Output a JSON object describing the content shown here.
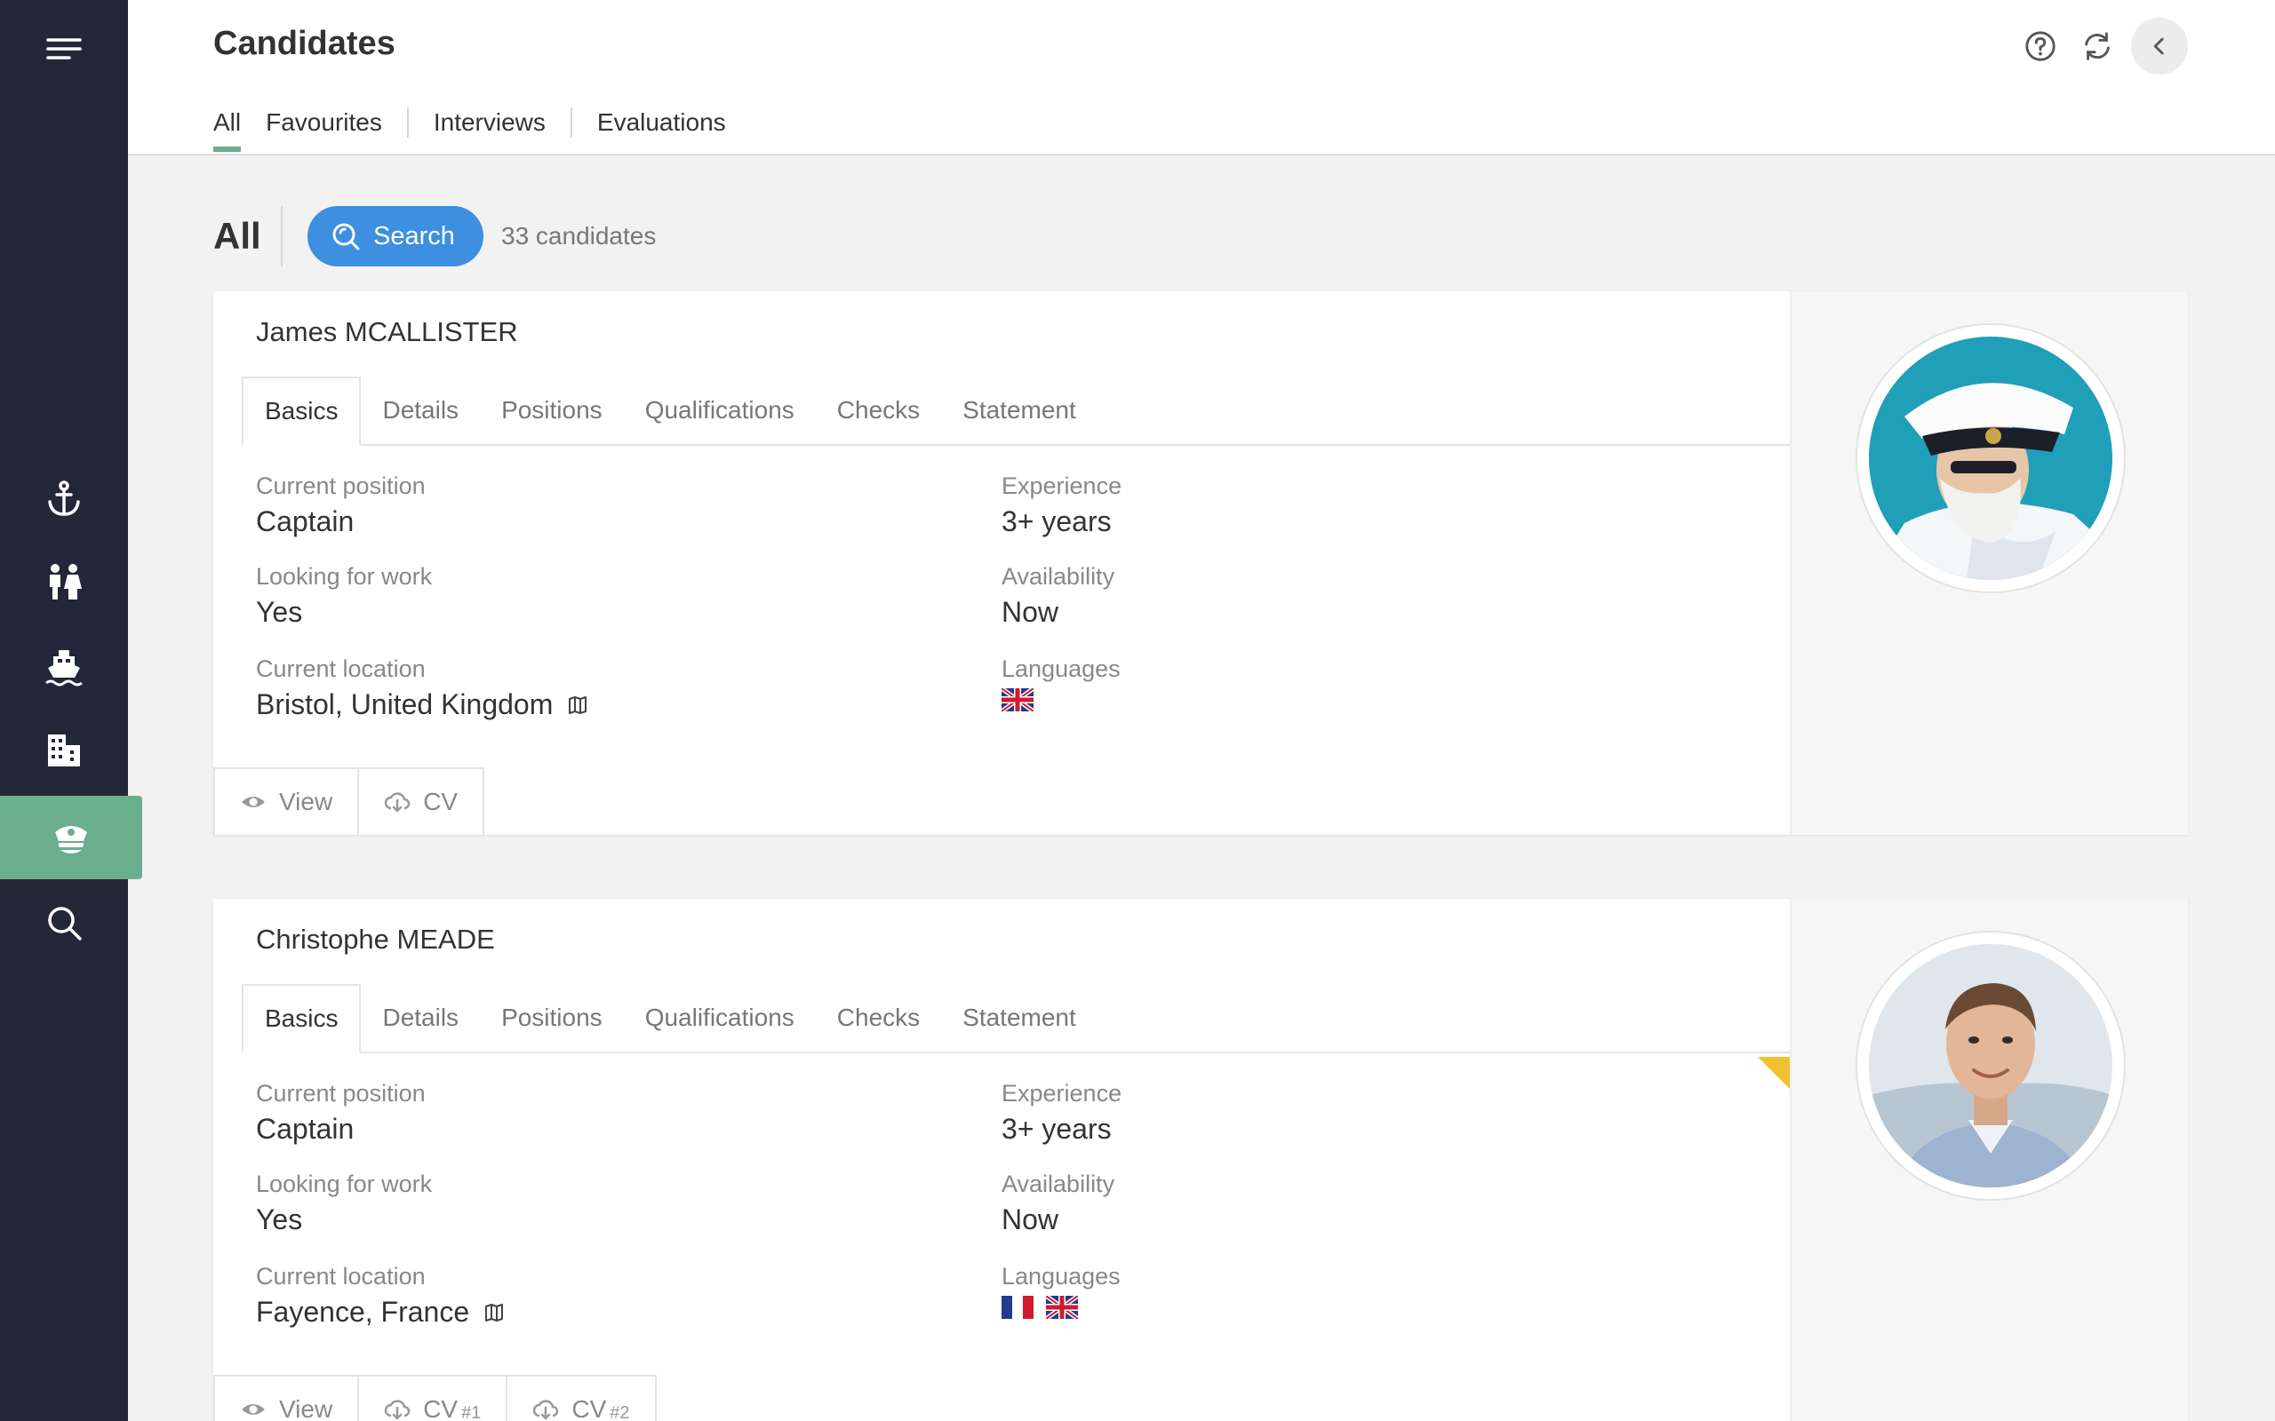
{
  "header": {
    "title": "Candidates",
    "tabs": [
      "All",
      "Favourites",
      "Interviews",
      "Evaluations"
    ],
    "active_tab": "All"
  },
  "sidebar": {
    "items": [
      "menu-icon",
      "anchor-icon",
      "crew-icon",
      "ship-icon",
      "buildings-icon",
      "captain-hat-icon",
      "search-icon"
    ],
    "active": "captain-hat-icon"
  },
  "toolbar": {
    "title": "All",
    "search_label": "Search",
    "count": "33 candidates"
  },
  "card_tabs": [
    "Basics",
    "Details",
    "Positions",
    "Qualifications",
    "Checks",
    "Statement"
  ],
  "candidates": [
    {
      "name": "James MCALLISTER",
      "current_position_label": "Current position",
      "current_position": "Captain",
      "looking_label": "Looking for work",
      "looking": "Yes",
      "location_label": "Current location",
      "location": "Bristol, United Kingdom",
      "experience_label": "Experience",
      "experience": "3+ years",
      "availability_label": "Availability",
      "availability": "Now",
      "languages_label": "Languages",
      "languages": [
        "gb-flag"
      ],
      "actions": [
        {
          "label": "View",
          "num": ""
        },
        {
          "label": "CV",
          "num": ""
        }
      ]
    },
    {
      "name": "Christophe MEADE",
      "current_position_label": "Current position",
      "current_position": "Captain",
      "looking_label": "Looking for work",
      "looking": "Yes",
      "location_label": "Current location",
      "location": "Fayence, France",
      "experience_label": "Experience",
      "experience": "3+ years",
      "availability_label": "Availability",
      "availability": "Now",
      "languages_label": "Languages",
      "languages": [
        "fr-flag",
        "gb-flag"
      ],
      "actions": [
        {
          "label": "View",
          "num": ""
        },
        {
          "label": "CV",
          "num": "#1"
        },
        {
          "label": "CV",
          "num": "#2"
        }
      ]
    }
  ],
  "colors": {
    "sidebar": "#232838",
    "accent": "#6aae8d",
    "search": "#3d8fe0",
    "corner_flag": "#f2c12e"
  }
}
